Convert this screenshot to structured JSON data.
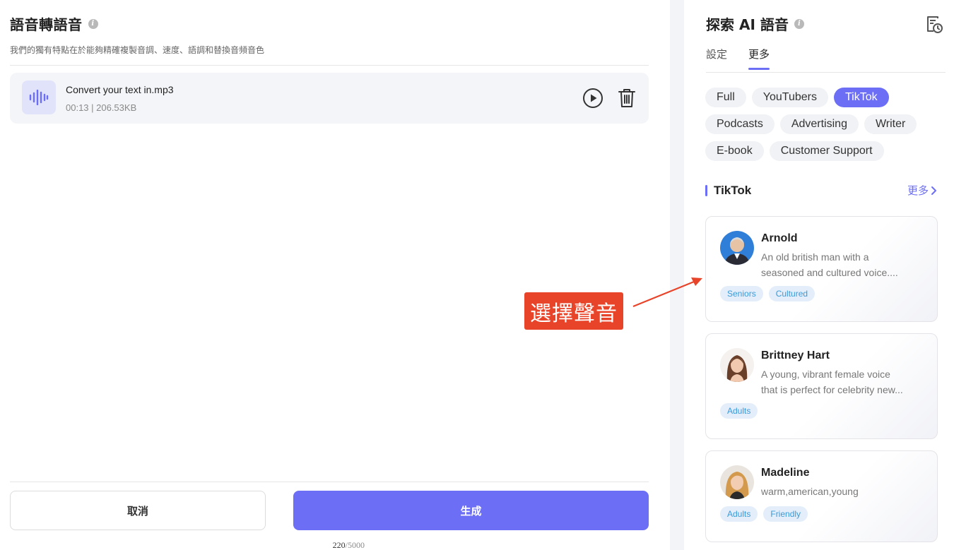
{
  "left": {
    "title": "語音轉語音",
    "subtitle": "我們的獨有特點在於能夠精確複製音調、速度、語調和替換音頻音色",
    "file": {
      "name": "Convert your text in.mp3",
      "meta": "00:13 | 206.53KB"
    },
    "cancel_label": "取消",
    "generate_label": "生成",
    "char_count": "220",
    "char_max": "/5000"
  },
  "right": {
    "title": "探索 AI 語音",
    "tabs": [
      {
        "label": "設定",
        "active": false
      },
      {
        "label": "更多",
        "active": true
      }
    ],
    "chips": [
      {
        "label": "Full",
        "active": false
      },
      {
        "label": "YouTubers",
        "active": false
      },
      {
        "label": "TikTok",
        "active": true
      },
      {
        "label": "Podcasts",
        "active": false
      },
      {
        "label": "Advertising",
        "active": false
      },
      {
        "label": "Writer",
        "active": false
      },
      {
        "label": "E-book",
        "active": false
      },
      {
        "label": "Customer Support",
        "active": false
      }
    ],
    "section_title": "TikTok",
    "more_label": "更多",
    "voices": [
      {
        "name": "Arnold",
        "desc_line1": "An old british man with a",
        "desc_line2": "seasoned and cultured voice....",
        "tags": [
          "Seniors",
          "Cultured"
        ]
      },
      {
        "name": "Brittney Hart",
        "desc_line1": "A young, vibrant female voice",
        "desc_line2": "that is perfect for celebrity new...",
        "tags": [
          "Adults"
        ]
      },
      {
        "name": "Madeline",
        "desc_line1": "warm,american,young",
        "desc_line2": "",
        "tags": [
          "Adults",
          "Friendly"
        ]
      }
    ]
  },
  "annotation": {
    "label": "選擇聲音"
  },
  "colors": {
    "accent": "#6c6ef5",
    "annotation": "#e8442a",
    "tag_bg": "#e3eefa",
    "tag_text": "#3a9ad9"
  },
  "icons": [
    "info-icon",
    "waveform-icon",
    "play-icon",
    "trash-icon",
    "history-icon",
    "chevron-right-icon"
  ]
}
